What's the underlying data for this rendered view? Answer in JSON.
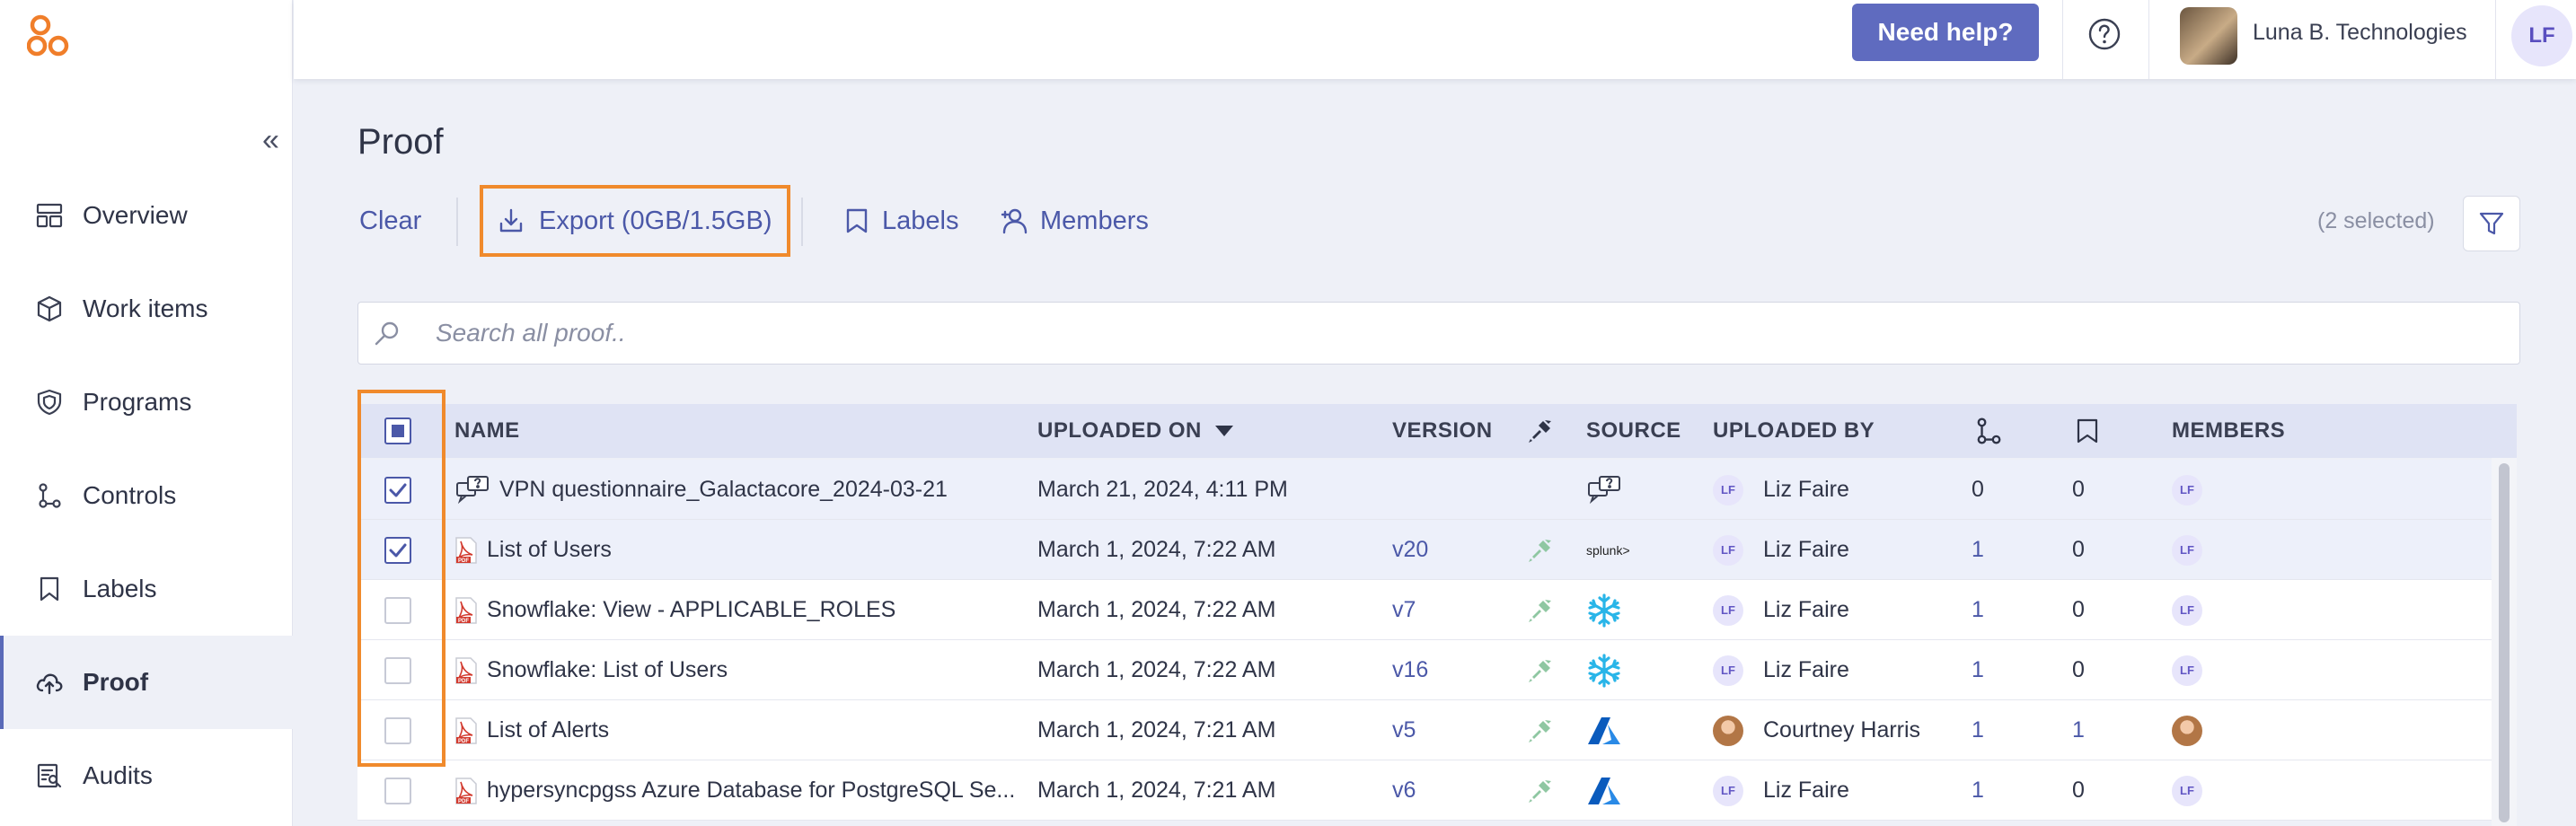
{
  "sidebar": {
    "collapse_glyph": "«",
    "items": [
      {
        "label": "Overview",
        "icon": "overview-icon"
      },
      {
        "label": "Work items",
        "icon": "cube-icon"
      },
      {
        "label": "Programs",
        "icon": "shield-icon"
      },
      {
        "label": "Controls",
        "icon": "controls-icon"
      },
      {
        "label": "Labels",
        "icon": "label-icon"
      },
      {
        "label": "Proof",
        "icon": "cloud-upload-icon",
        "active": true
      },
      {
        "label": "Audits",
        "icon": "audit-icon"
      }
    ]
  },
  "topbar": {
    "help_label": "Need help?",
    "org_name": "Luna B. Technologies",
    "user_initials": "LF"
  },
  "page": {
    "title": "Proof"
  },
  "toolbar": {
    "clear_label": "Clear",
    "export_label": "Export (0GB/1.5GB)",
    "labels_label": "Labels",
    "members_label": "Members",
    "selected_count": "(2 selected)"
  },
  "search": {
    "placeholder": "Search all proof..",
    "value": ""
  },
  "table": {
    "columns": {
      "name": "NAME",
      "uploaded_on": "UPLOADED ON",
      "version": "VERSION",
      "source": "SOURCE",
      "uploaded_by": "UPLOADED BY",
      "members": "MEMBERS"
    },
    "rows": [
      {
        "checked": true,
        "file_icon": "questionnaire-icon",
        "name": "VPN questionnaire_Galactacore_2024-03-21",
        "uploaded_on": "March 21, 2024, 4:11 PM",
        "version": "",
        "integration": false,
        "source": "questionnaire-icon",
        "uploaded_by": "Liz Faire",
        "uploader_initials": "LF",
        "controls": "0",
        "labels": "0",
        "member_initials": "LF"
      },
      {
        "checked": true,
        "file_icon": "pdf-icon",
        "name": "List of Users",
        "uploaded_on": "March 1, 2024, 7:22 AM",
        "version": "v20",
        "integration": true,
        "source": "splunk",
        "source_text": "splunk>",
        "uploaded_by": "Liz Faire",
        "uploader_initials": "LF",
        "controls": "1",
        "labels": "0",
        "member_initials": "LF"
      },
      {
        "checked": false,
        "file_icon": "pdf-icon",
        "name": "Snowflake: View - APPLICABLE_ROLES",
        "uploaded_on": "March 1, 2024, 7:22 AM",
        "version": "v7",
        "integration": true,
        "source": "snowflake-icon",
        "uploaded_by": "Liz Faire",
        "uploader_initials": "LF",
        "controls": "1",
        "labels": "0",
        "member_initials": "LF"
      },
      {
        "checked": false,
        "file_icon": "pdf-icon",
        "name": "Snowflake: List of Users",
        "uploaded_on": "March 1, 2024, 7:22 AM",
        "version": "v16",
        "integration": true,
        "source": "snowflake-icon",
        "uploaded_by": "Liz Faire",
        "uploader_initials": "LF",
        "controls": "1",
        "labels": "0",
        "member_initials": "LF"
      },
      {
        "checked": false,
        "file_icon": "pdf-icon",
        "name": "List of Alerts",
        "uploaded_on": "March 1, 2024, 7:21 AM",
        "version": "v5",
        "integration": true,
        "source": "azure-icon",
        "uploaded_by": "Courtney Harris",
        "uploader_initials": "",
        "uploader_photo": true,
        "controls": "1",
        "labels": "1",
        "member_initials": "",
        "member_photo": true
      },
      {
        "checked": false,
        "file_icon": "pdf-icon",
        "name": "hypersyncpgss Azure Database for PostgreSQL Se...",
        "uploaded_on": "March 1, 2024, 7:21 AM",
        "version": "v6",
        "integration": true,
        "source": "azure-icon",
        "uploaded_by": "Liz Faire",
        "uploader_initials": "LF",
        "controls": "1",
        "labels": "0",
        "member_initials": "LF"
      }
    ]
  },
  "colors": {
    "accent": "#4b58a8",
    "help_button": "#5f6bbf",
    "highlight_box": "#f08a2c",
    "header_row": "#dfe3f4",
    "selected_row": "#edf0fa",
    "logo": "#f07e2a"
  }
}
